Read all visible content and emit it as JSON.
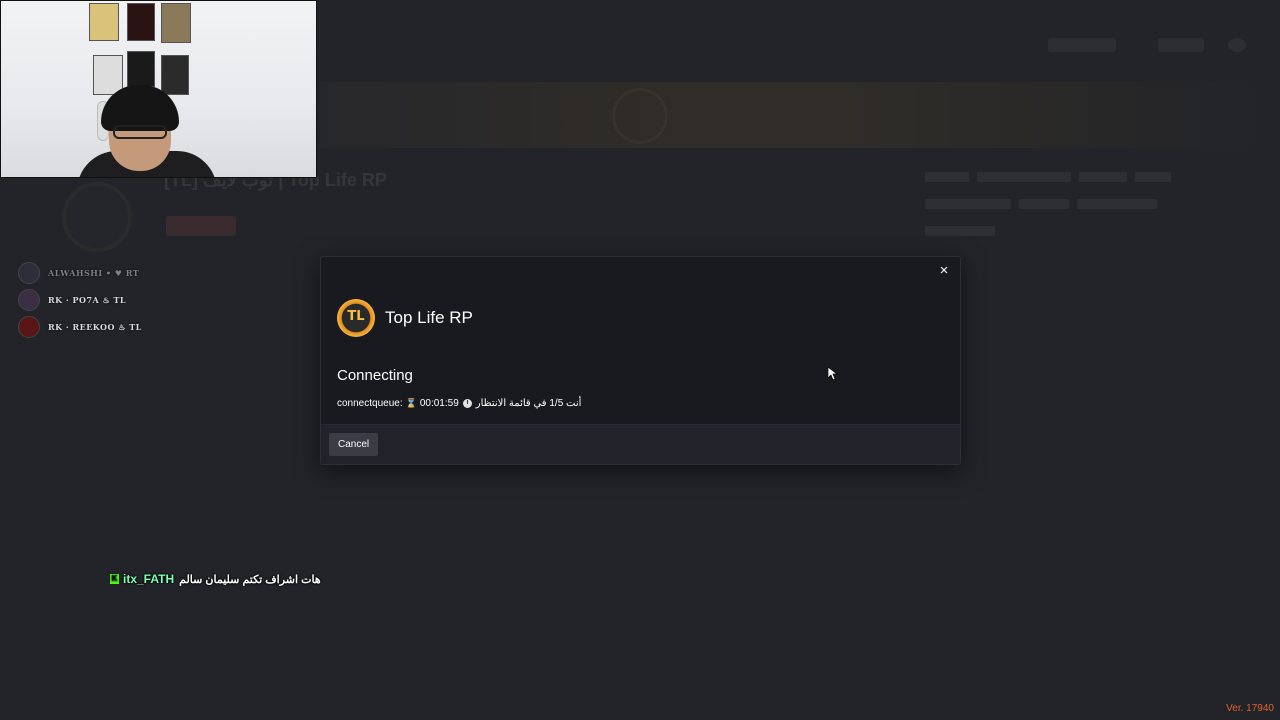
{
  "background": {
    "server_title": "[TL] توب لايف | Top Life RP"
  },
  "voice_users": [
    {
      "name": "ALWAHSHI • ♥ RT",
      "dim": true
    },
    {
      "name": "RK · PO7A ♨ TL",
      "dim": false
    },
    {
      "name": "RK · REEKOO ♨ TL",
      "dim": false
    }
  ],
  "chat": {
    "badge": "K",
    "user": "itx_FATH",
    "message": "هات اشراف تكتم سليمان سالم"
  },
  "modal": {
    "close_icon": "×",
    "server_logo_text": "TL",
    "title": "Top Life RP",
    "status": "Connecting",
    "queue_label": "connectqueue:",
    "queue_time": "00:01:59",
    "queue_position_text": "أنت 1/5 في قائمة الانتظار",
    "cancel_label": "Cancel"
  },
  "version": "Ver. 17940",
  "colors": {
    "background": "#23242a",
    "modal_bg": "#191a20",
    "modal_footer": "#22232a",
    "button_bg": "#3b3c44",
    "version_text": "#e0642a",
    "chat_user": "#7dffb2",
    "kick_badge": "#53fc18"
  }
}
